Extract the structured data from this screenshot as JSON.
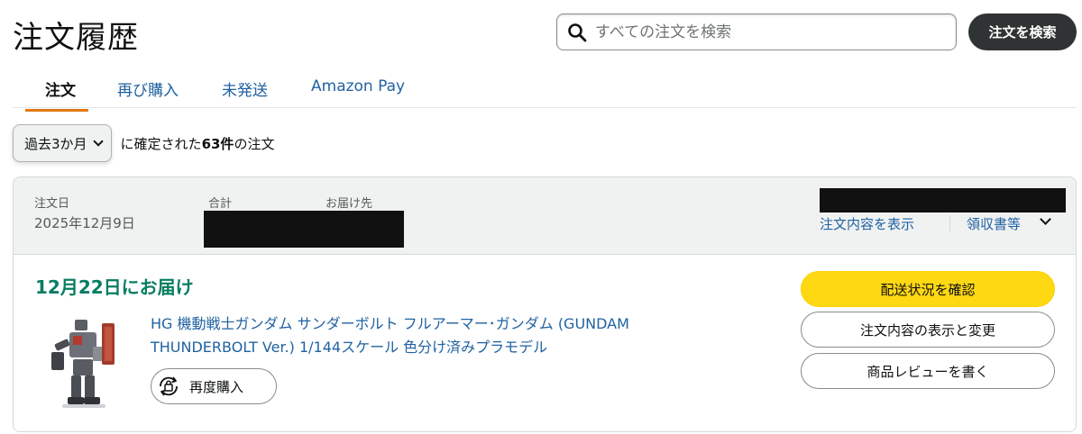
{
  "page": {
    "title": "注文履歴"
  },
  "search": {
    "placeholder": "すべての注文を検索",
    "button_label": "注文を検索"
  },
  "tabs": [
    {
      "label": "注文",
      "active": true
    },
    {
      "label": "再び購入",
      "active": false
    },
    {
      "label": "未発送",
      "active": false
    },
    {
      "label": "Amazon Pay",
      "active": false
    }
  ],
  "filter": {
    "period": "過去3か月",
    "summary_prefix": "に確定された",
    "count": "63件",
    "summary_suffix": "の注文"
  },
  "order": {
    "header": {
      "date_label": "注文日",
      "date_value": "2025年12月9日",
      "total_label": "合計",
      "ship_to_label": "お届け先",
      "details_link": "注文内容を表示",
      "receipt_link": "領収書等"
    },
    "delivery_status": "12月22日にお届け",
    "product": {
      "title": "HG 機動戦士ガンダム サンダーボルト フルアーマー･ガンダム (GUNDAM THUNDERBOLT Ver.) 1/144スケール 色分け済みプラモデル",
      "rebuy_label": "再度購入"
    },
    "actions": {
      "track": "配送状況を確認",
      "view_edit": "注文内容の表示と変更",
      "review": "商品レビューを書く"
    }
  },
  "colors": {
    "accent_tab": "#e47911",
    "link": "#2162a1",
    "delivery_green": "#067d62",
    "primary_button": "#ffd814",
    "search_button": "#303333"
  }
}
